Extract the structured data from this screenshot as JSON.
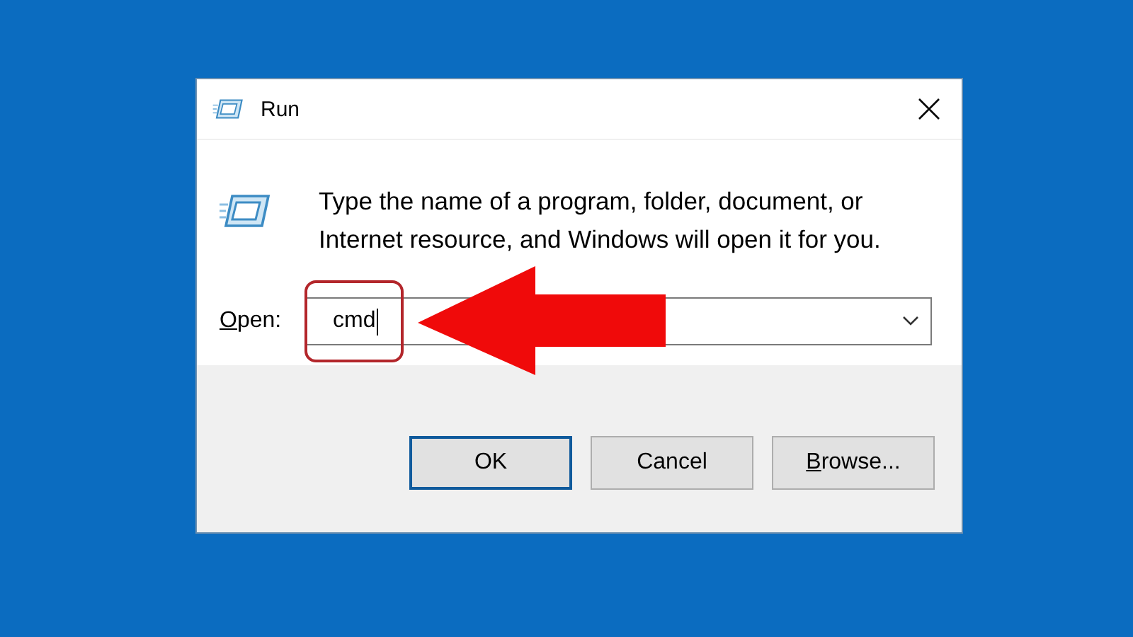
{
  "window": {
    "title": "Run"
  },
  "description": "Type the name of a program, folder, document, or Internet resource, and Windows will open it for you.",
  "open": {
    "label_key": "O",
    "label_rest": "pen:",
    "value": "cmd"
  },
  "buttons": [
    {
      "label": "OK",
      "default": true
    },
    {
      "label": "Cancel",
      "default": false
    },
    {
      "key": "B",
      "label": "rowse...",
      "default": false
    }
  ]
}
